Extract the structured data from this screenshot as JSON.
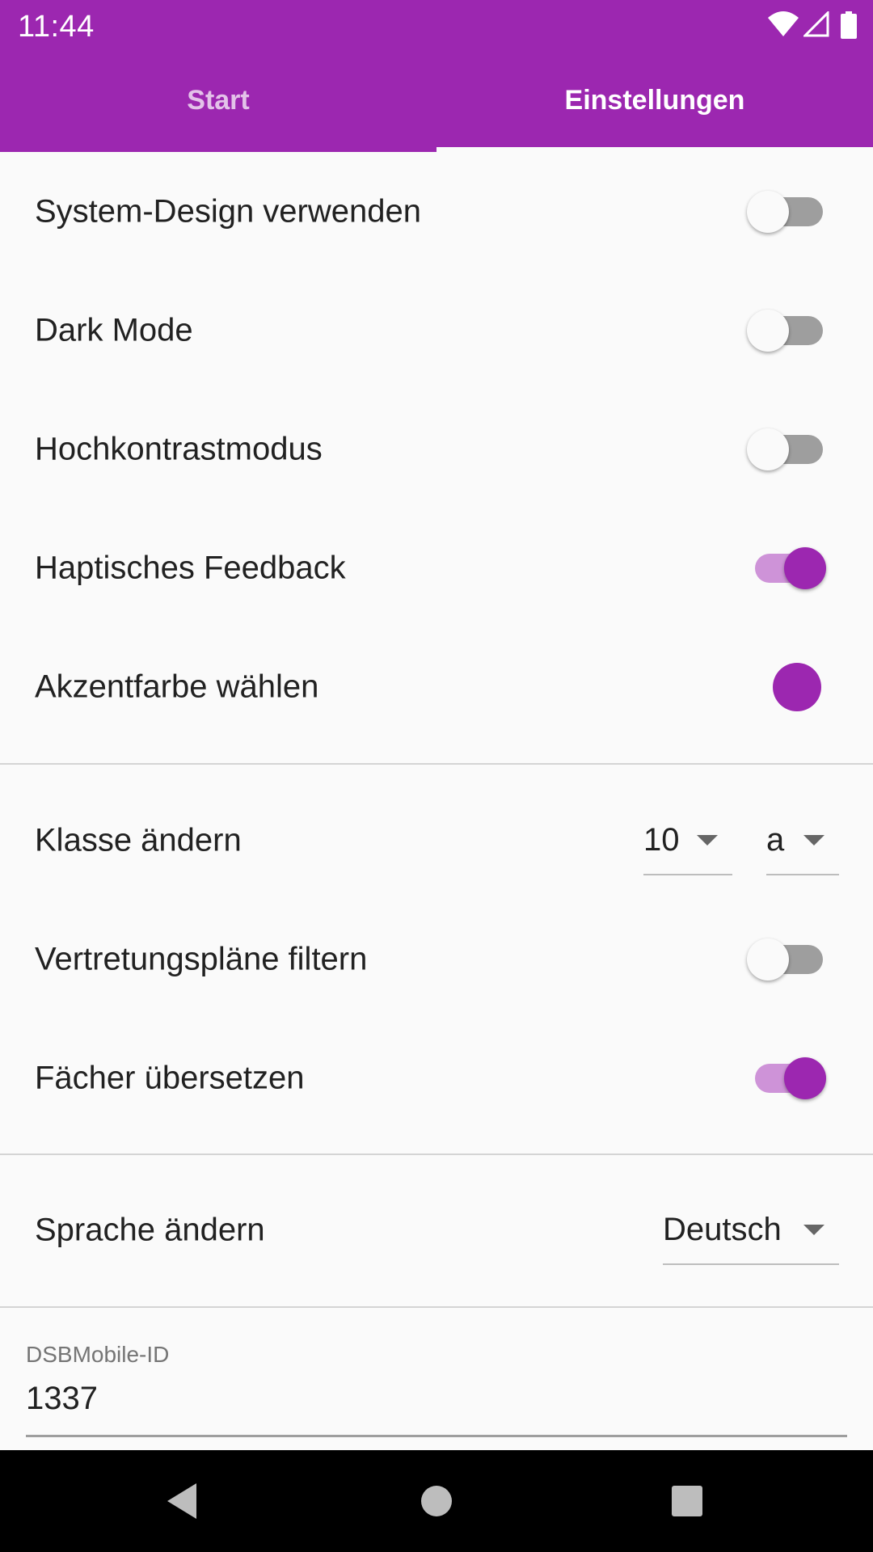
{
  "status_bar": {
    "time": "11:44",
    "icons": [
      "wifi-icon",
      "cell-signal-icon",
      "battery-icon"
    ]
  },
  "tabs": [
    {
      "label": "Start",
      "active": false
    },
    {
      "label": "Einstellungen",
      "active": true
    }
  ],
  "colors": {
    "primary": "#9c27b0",
    "switch_track_on": "#ce93d8",
    "switch_track_off": "#9e9e9e",
    "background": "#fafafa"
  },
  "settings": {
    "system_design": {
      "label": "System-Design verwenden",
      "enabled": false
    },
    "dark_mode": {
      "label": "Dark Mode",
      "enabled": false
    },
    "high_contrast": {
      "label": "Hochkontrastmodus",
      "enabled": false
    },
    "haptic_feedback": {
      "label": "Haptisches Feedback",
      "enabled": true
    },
    "accent_color": {
      "label": "Akzentfarbe wählen",
      "color": "#9c27b0"
    },
    "class": {
      "label": "Klasse ändern",
      "grade": "10",
      "letter": "a"
    },
    "filter_plans": {
      "label": "Vertretungspläne filtern",
      "enabled": false
    },
    "translate_subjects": {
      "label": "Fächer übersetzen",
      "enabled": true
    },
    "language": {
      "label": "Sprache ändern",
      "value": "Deutsch"
    },
    "dsbmobile_id": {
      "label": "DSBMobile-ID",
      "value": "1337"
    }
  },
  "navbar": {
    "buttons": [
      "back-icon",
      "home-icon",
      "recents-icon"
    ]
  }
}
